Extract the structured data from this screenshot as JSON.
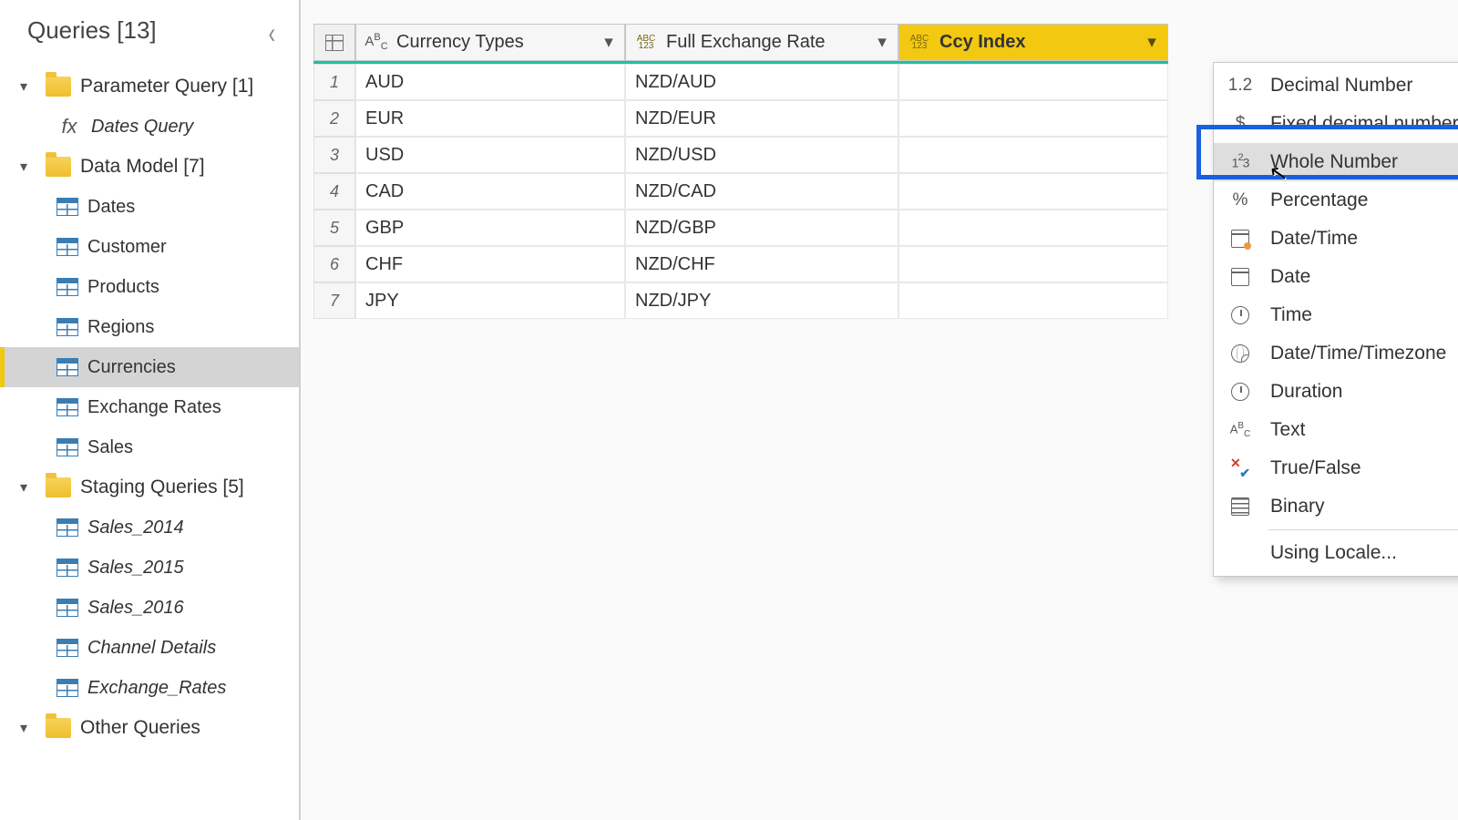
{
  "sidebar": {
    "title": "Queries [13]",
    "groups": [
      {
        "label": "Parameter Query [1]",
        "type": "folder",
        "items": [
          {
            "label": "Dates Query",
            "icon": "fx",
            "italic": true
          }
        ]
      },
      {
        "label": "Data Model [7]",
        "type": "folder",
        "items": [
          {
            "label": "Dates",
            "icon": "table"
          },
          {
            "label": "Customer",
            "icon": "table"
          },
          {
            "label": "Products",
            "icon": "table"
          },
          {
            "label": "Regions",
            "icon": "table"
          },
          {
            "label": "Currencies",
            "icon": "table",
            "selected": true
          },
          {
            "label": "Exchange Rates",
            "icon": "table"
          },
          {
            "label": "Sales",
            "icon": "table"
          }
        ]
      },
      {
        "label": "Staging Queries [5]",
        "type": "folder",
        "items": [
          {
            "label": "Sales_2014",
            "icon": "table",
            "italic": true
          },
          {
            "label": "Sales_2015",
            "icon": "table",
            "italic": true
          },
          {
            "label": "Sales_2016",
            "icon": "table",
            "italic": true
          },
          {
            "label": "Channel Details",
            "icon": "table",
            "italic": true
          },
          {
            "label": "Exchange_Rates",
            "icon": "table",
            "italic": true
          }
        ]
      },
      {
        "label": "Other Queries",
        "type": "folder",
        "items": []
      }
    ]
  },
  "table": {
    "columns": [
      {
        "name": "Currency Types",
        "type_glyph": "ABC"
      },
      {
        "name": "Full Exchange Rate",
        "type_glyph": "ABC123"
      },
      {
        "name": "Ccy Index",
        "type_glyph": "ABC123",
        "selected": true
      }
    ],
    "rows": [
      {
        "n": "1",
        "c1": "AUD",
        "c2": "NZD/AUD"
      },
      {
        "n": "2",
        "c1": "EUR",
        "c2": "NZD/EUR"
      },
      {
        "n": "3",
        "c1": "USD",
        "c2": "NZD/USD"
      },
      {
        "n": "4",
        "c1": "CAD",
        "c2": "NZD/CAD"
      },
      {
        "n": "5",
        "c1": "GBP",
        "c2": "NZD/GBP"
      },
      {
        "n": "6",
        "c1": "CHF",
        "c2": "NZD/CHF"
      },
      {
        "n": "7",
        "c1": "JPY",
        "c2": "NZD/JPY"
      }
    ]
  },
  "type_menu": {
    "items": [
      {
        "label": "Decimal Number",
        "icon": "1.2"
      },
      {
        "label": "Fixed decimal number",
        "icon": "$"
      },
      {
        "label": "Whole Number",
        "icon": "123",
        "highlight": true
      },
      {
        "label": "Percentage",
        "icon": "%"
      },
      {
        "label": "Date/Time",
        "icon": "cal-dt"
      },
      {
        "label": "Date",
        "icon": "cal"
      },
      {
        "label": "Time",
        "icon": "clock"
      },
      {
        "label": "Date/Time/Timezone",
        "icon": "globe"
      },
      {
        "label": "Duration",
        "icon": "dur"
      },
      {
        "label": "Text",
        "icon": "ABC"
      },
      {
        "label": "True/False",
        "icon": "xv"
      },
      {
        "label": "Binary",
        "icon": "bin"
      }
    ],
    "footer": "Using Locale..."
  }
}
